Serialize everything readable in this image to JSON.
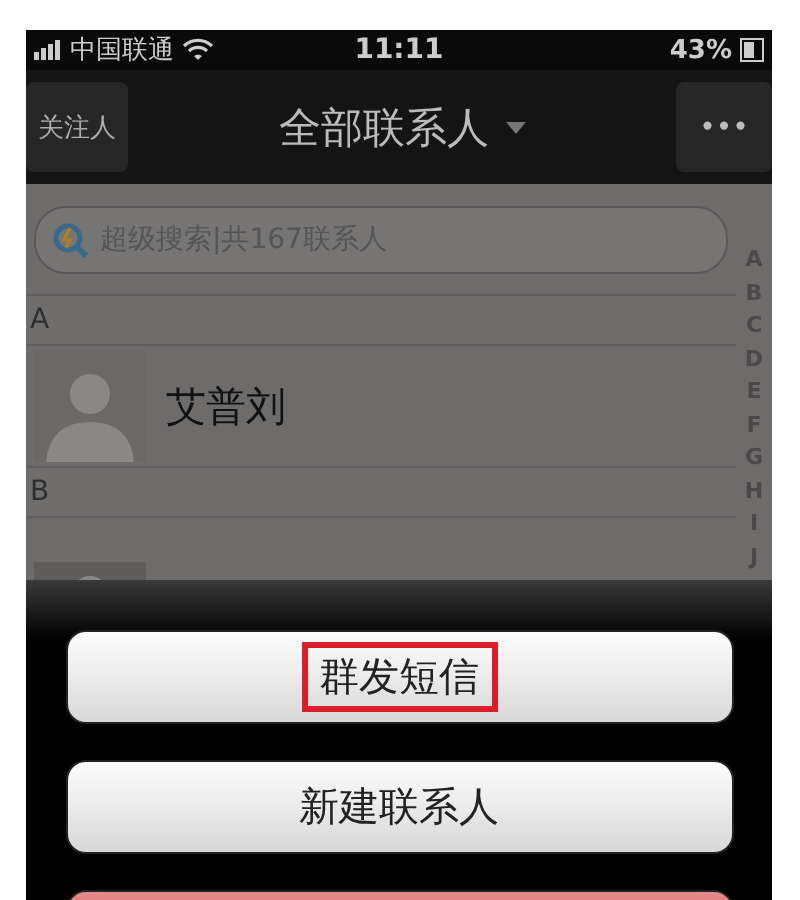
{
  "status_bar": {
    "carrier": "中国联通",
    "time": "11:11",
    "battery": "43%"
  },
  "nav": {
    "left_button": "关注人",
    "title": "全部联系人",
    "right_button": "•••"
  },
  "search": {
    "placeholder": "超级搜索|共167联系人"
  },
  "index": [
    "A",
    "B",
    "C",
    "D",
    "E",
    "F",
    "G",
    "H",
    "I",
    "J"
  ],
  "sections": [
    {
      "letter": "A",
      "contacts": [
        {
          "kind": "named",
          "name": "艾普刘"
        }
      ]
    },
    {
      "letter": "B",
      "contacts": [
        {
          "kind": "avatar_only"
        }
      ]
    }
  ],
  "action_sheet": {
    "actions": [
      {
        "kind": "normal",
        "label": "群发短信",
        "highlighted": true
      },
      {
        "kind": "normal",
        "label": "新建联系人",
        "highlighted": false
      },
      {
        "kind": "destructive"
      }
    ]
  }
}
